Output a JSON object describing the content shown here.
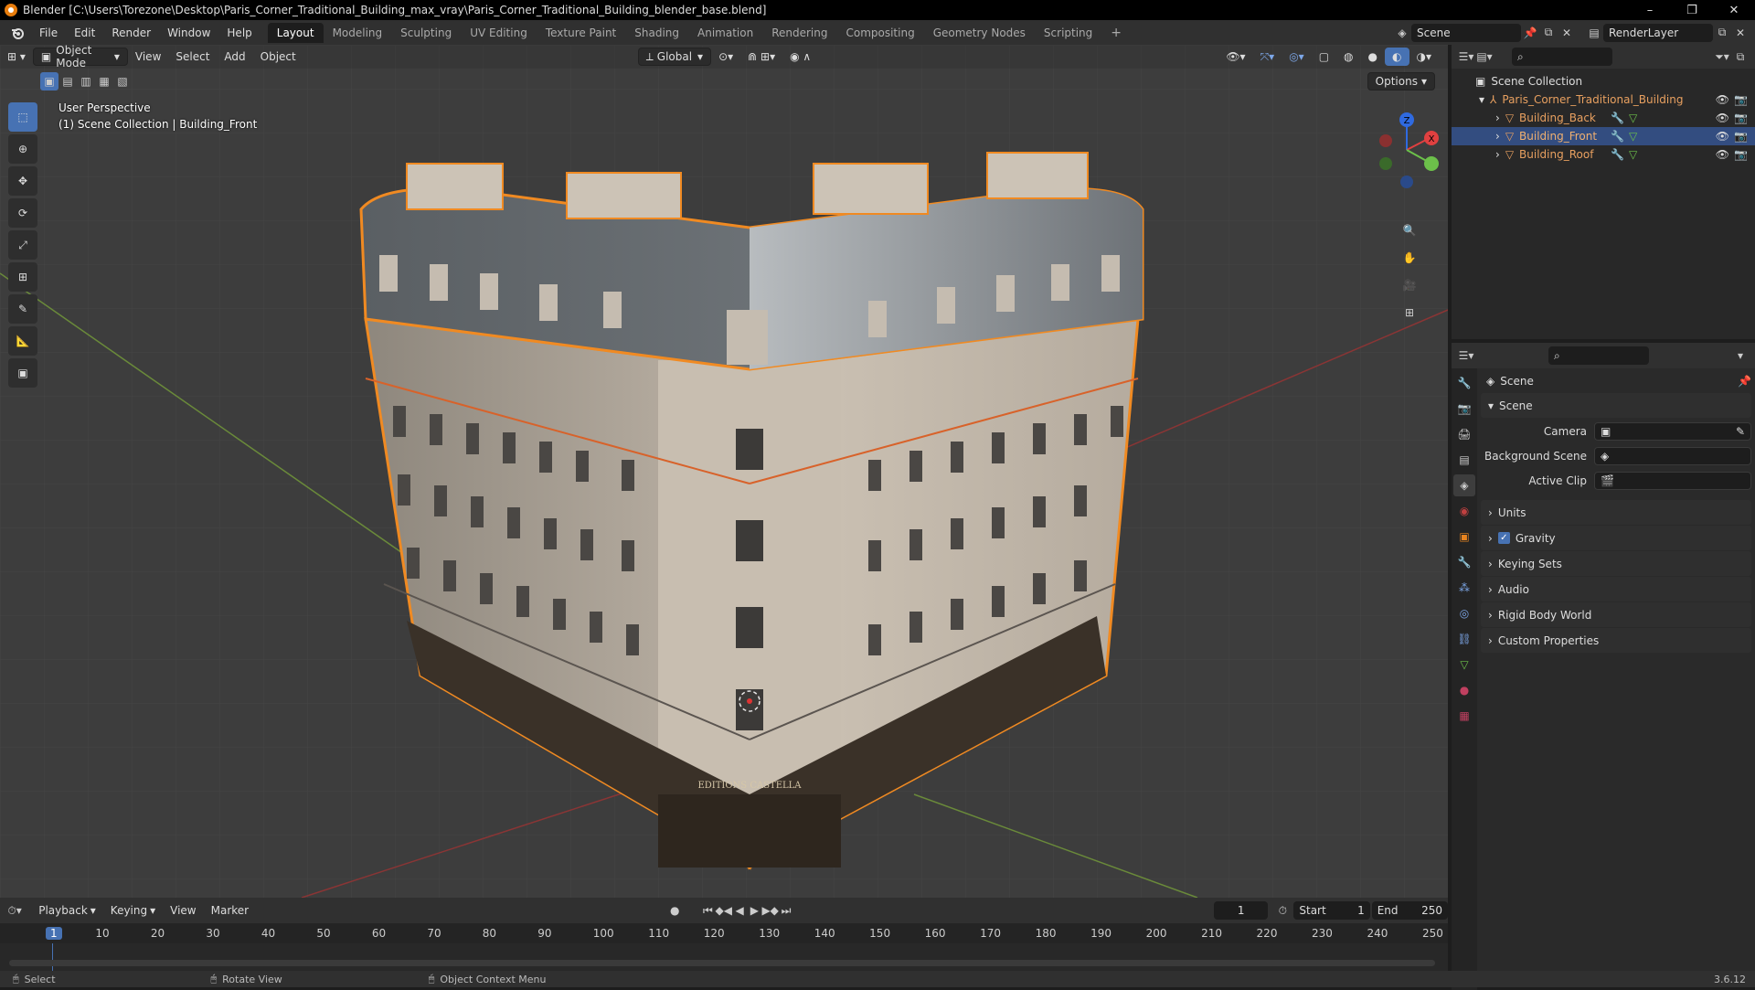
{
  "window": {
    "title": "Blender [C:\\Users\\Torezone\\Desktop\\Paris_Corner_Traditional_Building_max_vray\\Paris_Corner_Traditional_Building_blender_base.blend]",
    "minimize": "–",
    "maximize": "❐",
    "close": "✕"
  },
  "menu": [
    "File",
    "Edit",
    "Render",
    "Window",
    "Help"
  ],
  "workspaces": [
    "Layout",
    "Modeling",
    "Sculpting",
    "UV Editing",
    "Texture Paint",
    "Shading",
    "Animation",
    "Rendering",
    "Compositing",
    "Geometry Nodes",
    "Scripting"
  ],
  "workspace_add": "+",
  "scene_name": "Scene",
  "render_layer": "RenderLayer",
  "viewport": {
    "mode": "Object Mode",
    "menus": [
      "View",
      "Select",
      "Add",
      "Object"
    ],
    "transform_orientation": "Global",
    "options": "Options",
    "overlay_line1": "User Perspective",
    "overlay_line2": "(1) Scene Collection | Building_Front",
    "sign_text": "EDITIONS CASTELLA"
  },
  "outliner": {
    "root": "Scene Collection",
    "items": [
      {
        "name": "Paris_Corner_Traditional_Building",
        "level": 0
      },
      {
        "name": "Building_Back",
        "level": 1
      },
      {
        "name": "Building_Front",
        "level": 1,
        "selected": true
      },
      {
        "name": "Building_Roof",
        "level": 1
      }
    ]
  },
  "properties": {
    "context": "Scene",
    "section": "Scene",
    "fields": [
      {
        "label": "Camera",
        "value": ""
      },
      {
        "label": "Background Scene",
        "value": ""
      },
      {
        "label": "Active Clip",
        "value": ""
      }
    ],
    "panels": [
      "Units",
      "Gravity",
      "Keying Sets",
      "Audio",
      "Rigid Body World",
      "Custom Properties"
    ]
  },
  "timeline": {
    "menus": [
      "Playback",
      "Keying",
      "View",
      "Marker"
    ],
    "current_frame": "1",
    "start_label": "Start",
    "start": "1",
    "end_label": "End",
    "end": "250",
    "ticks": [
      "1",
      "10",
      "20",
      "30",
      "40",
      "50",
      "60",
      "70",
      "80",
      "90",
      "100",
      "110",
      "120",
      "130",
      "140",
      "150",
      "160",
      "170",
      "180",
      "190",
      "200",
      "210",
      "220",
      "230",
      "240",
      "250"
    ]
  },
  "status": {
    "select": "Select",
    "rotate": "Rotate View",
    "context_menu": "Object Context Menu",
    "version": "3.6.12"
  },
  "colors": {
    "accent": "#4772b3",
    "selection_orange": "#e8841f",
    "header": "#303030",
    "viewport_bg": "#3d3d3d"
  }
}
